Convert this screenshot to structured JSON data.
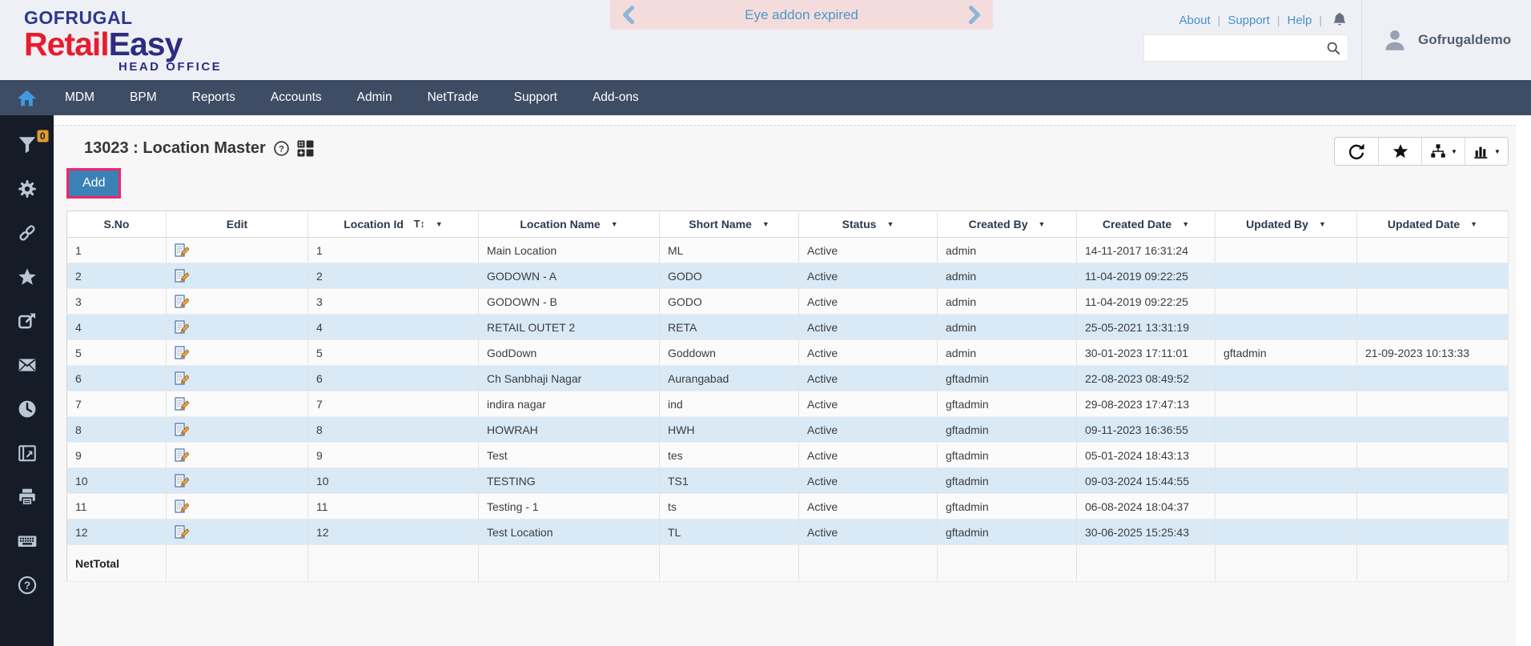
{
  "header": {
    "logo": {
      "brand": "GOFRUGAL",
      "product_red": "Retail",
      "product_navy": "Easy",
      "tagline": "HEAD OFFICE"
    },
    "notification_text": "Eye addon expired",
    "links": [
      "About",
      "Support",
      "Help"
    ],
    "links_separator": "|",
    "search_value": "",
    "user_name": "Gofrugaldemo"
  },
  "nav": {
    "items": [
      "MDM",
      "BPM",
      "Reports",
      "Accounts",
      "Admin",
      "NetTrade",
      "Support",
      "Add-ons"
    ]
  },
  "sidebar": {
    "filter_badge": "0"
  },
  "page": {
    "title": "13023 : Location Master",
    "add_button_label": "Add"
  },
  "table": {
    "caret_glyph": "▼",
    "columns": [
      {
        "key": "sno",
        "label": "S.No"
      },
      {
        "key": "edit",
        "label": "Edit"
      },
      {
        "key": "location_id",
        "label": "Location Id",
        "sort_glyph": "T↕",
        "filter": true
      },
      {
        "key": "location_name",
        "label": "Location Name",
        "filter": true
      },
      {
        "key": "short_name",
        "label": "Short Name",
        "filter": true
      },
      {
        "key": "status",
        "label": "Status",
        "filter": true
      },
      {
        "key": "created_by",
        "label": "Created By",
        "filter": true
      },
      {
        "key": "created_date",
        "label": "Created Date",
        "filter": true
      },
      {
        "key": "updated_by",
        "label": "Updated By",
        "filter": true
      },
      {
        "key": "updated_date",
        "label": "Updated Date",
        "filter": true
      }
    ],
    "rows": [
      {
        "sno": "1",
        "location_id": "1",
        "location_name": "Main Location",
        "short_name": "ML",
        "status": "Active",
        "created_by": "admin",
        "created_date": "14-11-2017 16:31:24",
        "updated_by": "",
        "updated_date": ""
      },
      {
        "sno": "2",
        "location_id": "2",
        "location_name": "GODOWN - A",
        "short_name": "GODO",
        "status": "Active",
        "created_by": "admin",
        "created_date": "11-04-2019 09:22:25",
        "updated_by": "",
        "updated_date": ""
      },
      {
        "sno": "3",
        "location_id": "3",
        "location_name": "GODOWN - B",
        "short_name": "GODO",
        "status": "Active",
        "created_by": "admin",
        "created_date": "11-04-2019 09:22:25",
        "updated_by": "",
        "updated_date": ""
      },
      {
        "sno": "4",
        "location_id": "4",
        "location_name": "RETAIL OUTET 2",
        "short_name": "RETA",
        "status": "Active",
        "created_by": "admin",
        "created_date": "25-05-2021 13:31:19",
        "updated_by": "",
        "updated_date": ""
      },
      {
        "sno": "5",
        "location_id": "5",
        "location_name": "GodDown",
        "short_name": "Goddown",
        "status": "Active",
        "created_by": "admin",
        "created_date": "30-01-2023 17:11:01",
        "updated_by": "gftadmin",
        "updated_date": "21-09-2023 10:13:33"
      },
      {
        "sno": "6",
        "location_id": "6",
        "location_name": "Ch Sanbhaji Nagar",
        "short_name": "Aurangabad",
        "status": "Active",
        "created_by": "gftadmin",
        "created_date": "22-08-2023 08:49:52",
        "updated_by": "",
        "updated_date": ""
      },
      {
        "sno": "7",
        "location_id": "7",
        "location_name": "indira nagar",
        "short_name": "ind",
        "status": "Active",
        "created_by": "gftadmin",
        "created_date": "29-08-2023 17:47:13",
        "updated_by": "",
        "updated_date": ""
      },
      {
        "sno": "8",
        "location_id": "8",
        "location_name": "HOWRAH",
        "short_name": "HWH",
        "status": "Active",
        "created_by": "gftadmin",
        "created_date": "09-11-2023 16:36:55",
        "updated_by": "",
        "updated_date": ""
      },
      {
        "sno": "9",
        "location_id": "9",
        "location_name": "Test",
        "short_name": "tes",
        "status": "Active",
        "created_by": "gftadmin",
        "created_date": "05-01-2024 18:43:13",
        "updated_by": "",
        "updated_date": ""
      },
      {
        "sno": "10",
        "location_id": "10",
        "location_name": "TESTING",
        "short_name": "TS1",
        "status": "Active",
        "created_by": "gftadmin",
        "created_date": "09-03-2024 15:44:55",
        "updated_by": "",
        "updated_date": ""
      },
      {
        "sno": "11",
        "location_id": "11",
        "location_name": "Testing - 1",
        "short_name": "ts",
        "status": "Active",
        "created_by": "gftadmin",
        "created_date": "06-08-2024 18:04:37",
        "updated_by": "",
        "updated_date": ""
      },
      {
        "sno": "12",
        "location_id": "12",
        "location_name": "Test Location",
        "short_name": "TL",
        "status": "Active",
        "created_by": "gftadmin",
        "created_date": "30-06-2025 15:25:43",
        "updated_by": "",
        "updated_date": ""
      }
    ],
    "net_total_label": "NetTotal"
  }
}
